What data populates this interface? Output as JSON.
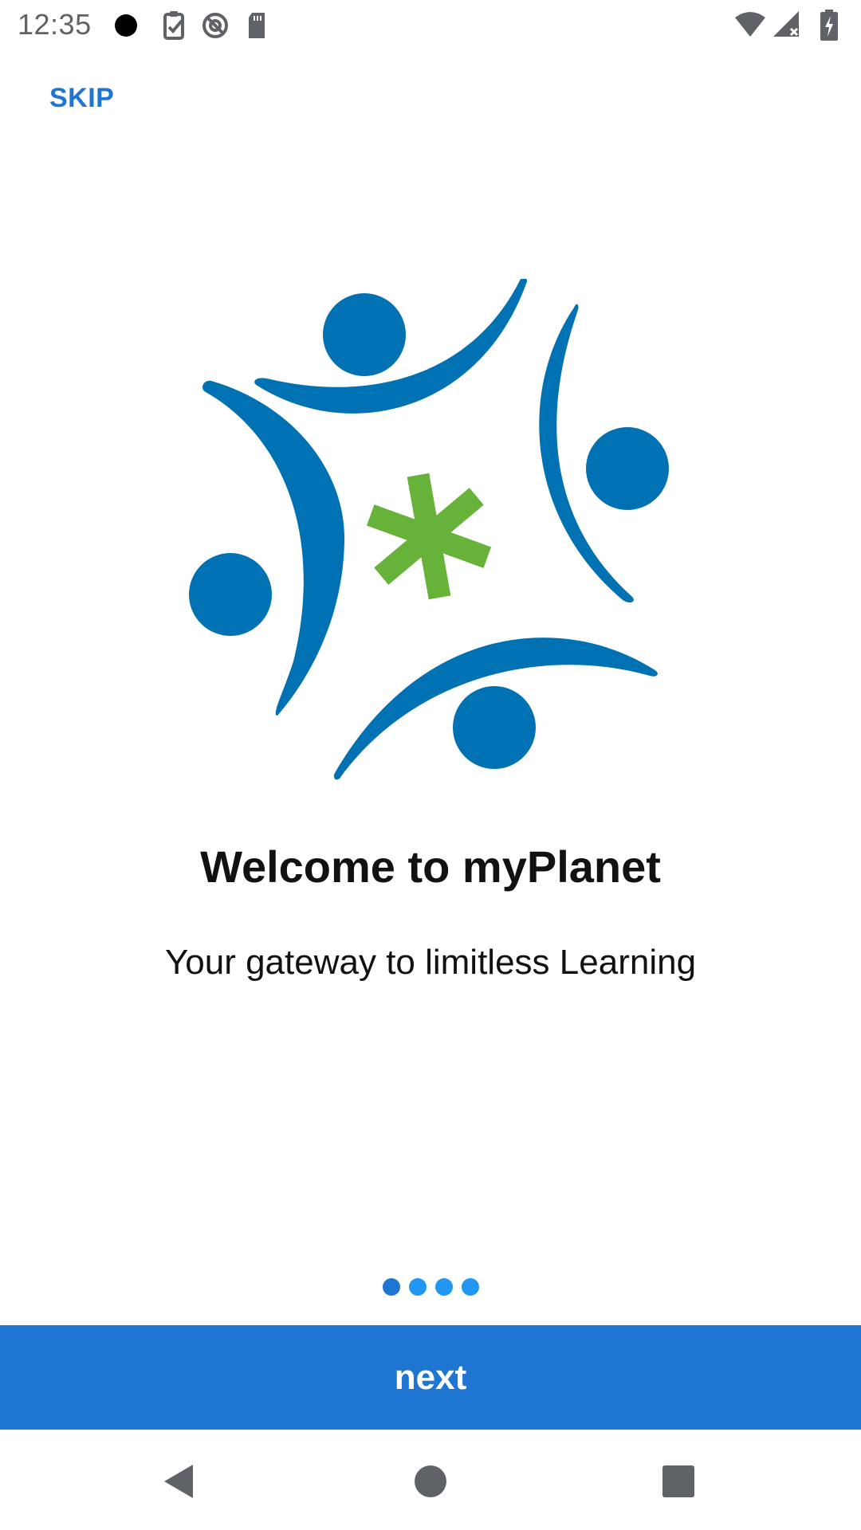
{
  "status_bar": {
    "time": "12:35",
    "left_icons": [
      "dot-icon",
      "clipboard-check-icon",
      "data-saver-icon",
      "sd-card-icon"
    ],
    "right_icons": [
      "wifi-icon",
      "cell-signal-icon",
      "battery-charging-icon"
    ]
  },
  "header": {
    "skip_label": "SKIP"
  },
  "logo": {
    "name": "myplanet-logo-icon",
    "colors": {
      "figures": "#0071b3",
      "star": "#67b33a"
    }
  },
  "onboarding": {
    "title": "Welcome to myPlanet",
    "subtitle": "Your gateway to limitless Learning",
    "page_count": 4,
    "current_page": 1
  },
  "footer": {
    "next_label": "next"
  },
  "nav_bar": {
    "items": [
      "back-icon",
      "home-icon",
      "recents-icon"
    ]
  },
  "colors": {
    "accent": "#1e76d2",
    "indicator_dot": "#2196f3",
    "text": "#111111"
  }
}
